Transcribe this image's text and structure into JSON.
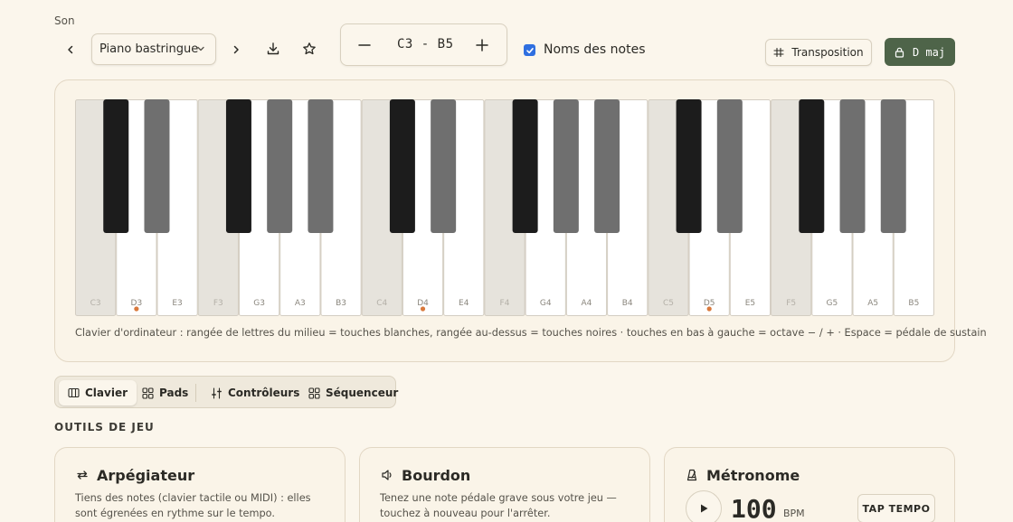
{
  "sound": {
    "label": "Son",
    "selected_instrument": "Piano bastringue"
  },
  "range": {
    "text": "C3 - B5"
  },
  "note_names": {
    "checked": true,
    "label": "Noms des notes"
  },
  "buttons": {
    "transposition": "Transposition",
    "key_lock": "D maj"
  },
  "piano": {
    "white_keys": [
      {
        "note": "C3",
        "out_of_scale": true,
        "dot": false
      },
      {
        "note": "D3",
        "out_of_scale": false,
        "dot": true
      },
      {
        "note": "E3",
        "out_of_scale": false,
        "dot": false
      },
      {
        "note": "F3",
        "out_of_scale": true,
        "dot": false
      },
      {
        "note": "G3",
        "out_of_scale": false,
        "dot": false
      },
      {
        "note": "A3",
        "out_of_scale": false,
        "dot": false
      },
      {
        "note": "B3",
        "out_of_scale": false,
        "dot": false
      },
      {
        "note": "C4",
        "out_of_scale": true,
        "dot": false
      },
      {
        "note": "D4",
        "out_of_scale": false,
        "dot": true
      },
      {
        "note": "E4",
        "out_of_scale": false,
        "dot": false
      },
      {
        "note": "F4",
        "out_of_scale": true,
        "dot": false
      },
      {
        "note": "G4",
        "out_of_scale": false,
        "dot": false
      },
      {
        "note": "A4",
        "out_of_scale": false,
        "dot": false
      },
      {
        "note": "B4",
        "out_of_scale": false,
        "dot": false
      },
      {
        "note": "C5",
        "out_of_scale": true,
        "dot": false
      },
      {
        "note": "D5",
        "out_of_scale": false,
        "dot": true
      },
      {
        "note": "E5",
        "out_of_scale": false,
        "dot": false
      },
      {
        "note": "F5",
        "out_of_scale": true,
        "dot": false
      },
      {
        "note": "G5",
        "out_of_scale": false,
        "dot": false
      },
      {
        "note": "A5",
        "out_of_scale": false,
        "dot": false
      },
      {
        "note": "B5",
        "out_of_scale": false,
        "dot": false
      }
    ],
    "black_keys": [
      {
        "after": 0,
        "in_scale": true
      },
      {
        "after": 1,
        "in_scale": false
      },
      {
        "after": 3,
        "in_scale": true
      },
      {
        "after": 4,
        "in_scale": false
      },
      {
        "after": 5,
        "in_scale": false
      },
      {
        "after": 7,
        "in_scale": true
      },
      {
        "after": 8,
        "in_scale": false
      },
      {
        "after": 10,
        "in_scale": true
      },
      {
        "after": 11,
        "in_scale": false
      },
      {
        "after": 12,
        "in_scale": false
      },
      {
        "after": 14,
        "in_scale": true
      },
      {
        "after": 15,
        "in_scale": false
      },
      {
        "after": 17,
        "in_scale": true
      },
      {
        "after": 18,
        "in_scale": false
      },
      {
        "after": 19,
        "in_scale": false
      }
    ],
    "colors": {
      "white": "#ffffff",
      "white_out_of_scale": "#e6e3dc",
      "black_in_scale": "#1c1c1c",
      "black_out_of_scale": "#6f6f6f",
      "dot": "#d9793c"
    }
  },
  "hint": "Clavier d'ordinateur : rangée de lettres du milieu = touches blanches, rangée au-dessus = touches noires · touches en bas à gauche = octave − / + · Espace = pédale de sustain",
  "tabs": [
    {
      "label": "Clavier",
      "icon": "keyboard-icon",
      "active": true
    },
    {
      "label": "Pads",
      "icon": "grid-icon",
      "active": false
    },
    {
      "label": "Contrôleurs",
      "icon": "sliders-icon",
      "active": false
    },
    {
      "label": "Séquenceur",
      "icon": "grid-icon",
      "active": false
    }
  ],
  "section_title": "OUTILS DE JEU",
  "tools": {
    "arpeggiator": {
      "title": "Arpégiateur",
      "icon": "repeat-icon",
      "description": "Tiens des notes (clavier tactile ou MIDI) : elles sont égrenées en rythme sur le tempo."
    },
    "drone": {
      "title": "Bourdon",
      "icon": "speaker-icon",
      "description": "Tenez une note pédale grave sous votre jeu — touchez à nouveau pour l'arrêter."
    },
    "metronome": {
      "title": "Métronome",
      "icon": "metronome-icon",
      "bpm": "100",
      "bpm_unit": "BPM",
      "tap_label": "TAP TEMPO"
    }
  },
  "colors": {
    "background": "#fbf6ec",
    "accent_green": "#4e6449",
    "checkbox_blue": "#2f6fe0"
  }
}
